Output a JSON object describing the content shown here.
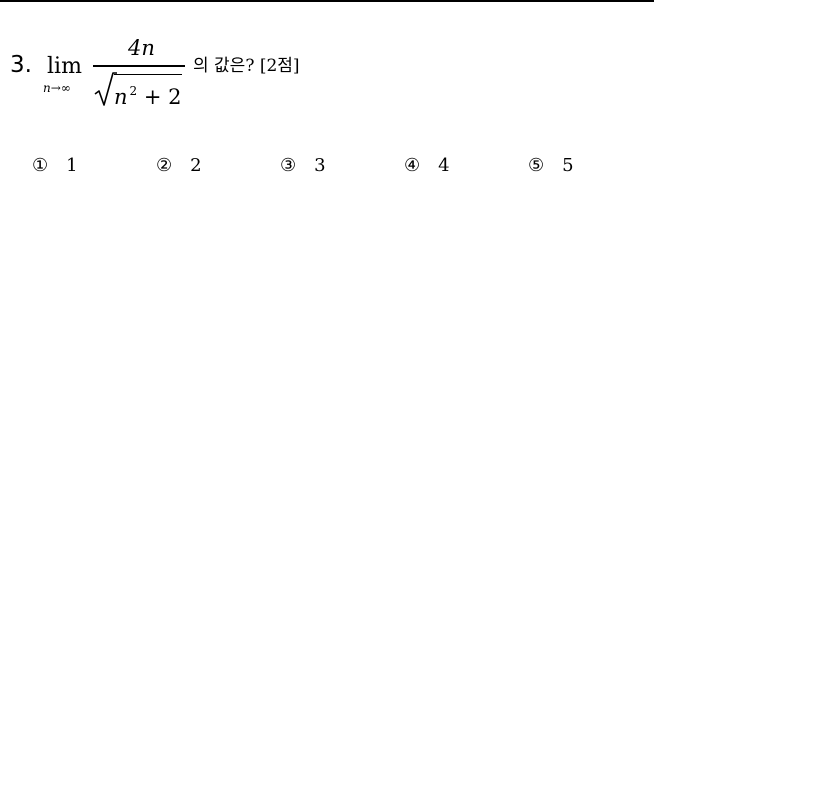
{
  "question": {
    "number": "3.",
    "limit_word": "lim",
    "limit_subscript": "n→∞",
    "numerator": "4n",
    "radicand_var": "n",
    "radicand_exponent": "2",
    "radicand_rest": "+ 2",
    "tail_text": "의 값은? [2점]"
  },
  "choices": [
    {
      "mark": "①",
      "value": "1"
    },
    {
      "mark": "②",
      "value": "2"
    },
    {
      "mark": "③",
      "value": "3"
    },
    {
      "mark": "④",
      "value": "4"
    },
    {
      "mark": "⑤",
      "value": "5"
    }
  ]
}
